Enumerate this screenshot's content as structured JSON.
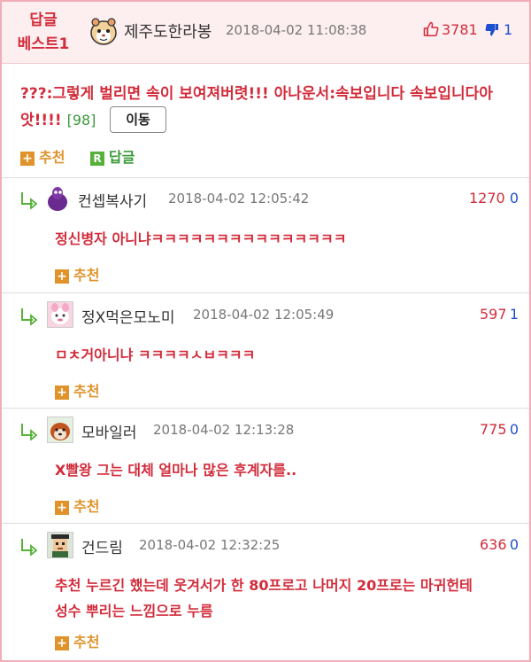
{
  "header": {
    "badge_line1": "답글",
    "badge_line2": "베스트1",
    "author": "제주도한라봉",
    "date": "2018-04-02 11:08:38",
    "up_count": "3781",
    "down_count": "1"
  },
  "post": {
    "text_line1": "???:그렇게 벌리면 속이 보여져버렷!!! 아나운서:속보입니다 속보입니다아",
    "text_line2": "앗!!!!",
    "comment_count": "[98]",
    "move_label": "이동",
    "recommend_label": "추천",
    "reply_label": "답글"
  },
  "replies": [
    {
      "author": "컨셉복사기",
      "date": "2018-04-02 12:05:42",
      "up": "1270",
      "down": "0",
      "text": "정신병자 아니냐ㅋㅋㅋㅋㅋㅋㅋㅋㅋㅋㅋㅋㅋㅋㅋ",
      "recommend_label": "추천"
    },
    {
      "author": "정X먹은모노미",
      "date": "2018-04-02 12:05:49",
      "up": "597",
      "down": "1",
      "text": "ㅁㅊ거아니냐 ㅋㅋㅋㅋㅅㅂㅋㅋㅋ",
      "recommend_label": "추천"
    },
    {
      "author": "모바일러",
      "date": "2018-04-02 12:13:28",
      "up": "775",
      "down": "0",
      "text": "X빨왕 그는 대체 얼마나 많은 후계자를..",
      "recommend_label": "추천"
    },
    {
      "author": "건드림",
      "date": "2018-04-02 12:32:25",
      "up": "636",
      "down": "0",
      "text_line1": "추천 누르긴 했는데 웃겨서가 한 80프로고 나머지 20프로는 마귀헌테",
      "text_line2": "성수 뿌리는 느낌으로 누름",
      "recommend_label": "추천"
    }
  ],
  "colors": {
    "accent_red": "#d22c3b",
    "accent_blue": "#1d4fcf",
    "accent_green": "#3a9a3a",
    "accent_orange": "#e0932a",
    "header_bg": "#fdeef0"
  }
}
